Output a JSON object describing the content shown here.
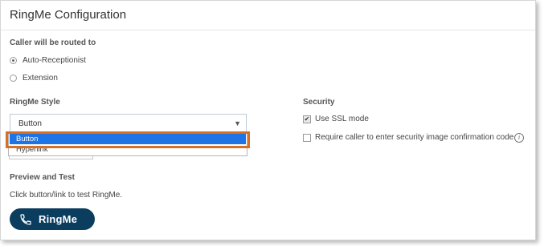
{
  "title": "RingMe Configuration",
  "routing": {
    "heading": "Caller will be routed to",
    "options": [
      {
        "label": "Auto-Receptionist",
        "checked": true
      },
      {
        "label": "Extension",
        "checked": false
      }
    ]
  },
  "style": {
    "heading": "RingMe Style",
    "selected_value": "Button",
    "dropdown_options": [
      "Button",
      "Hyperlink"
    ],
    "highlighted_option": "Button",
    "arrow_icon": "chevron-down-icon"
  },
  "security": {
    "heading": "Security",
    "options": [
      {
        "label": "Use SSL mode",
        "checked": true
      },
      {
        "label": "Require caller to enter security image confirmation code",
        "checked": false
      }
    ],
    "info_icon": "info-icon"
  },
  "preview": {
    "heading": "Preview and Test",
    "description": "Click button/link to test RingMe.",
    "button_label": "RingMe",
    "button_icon": "phone-icon"
  },
  "colors": {
    "accent": "#1e73e5",
    "highlight_outline": "#d96f23",
    "ringme_button": "#0b3d5f"
  }
}
